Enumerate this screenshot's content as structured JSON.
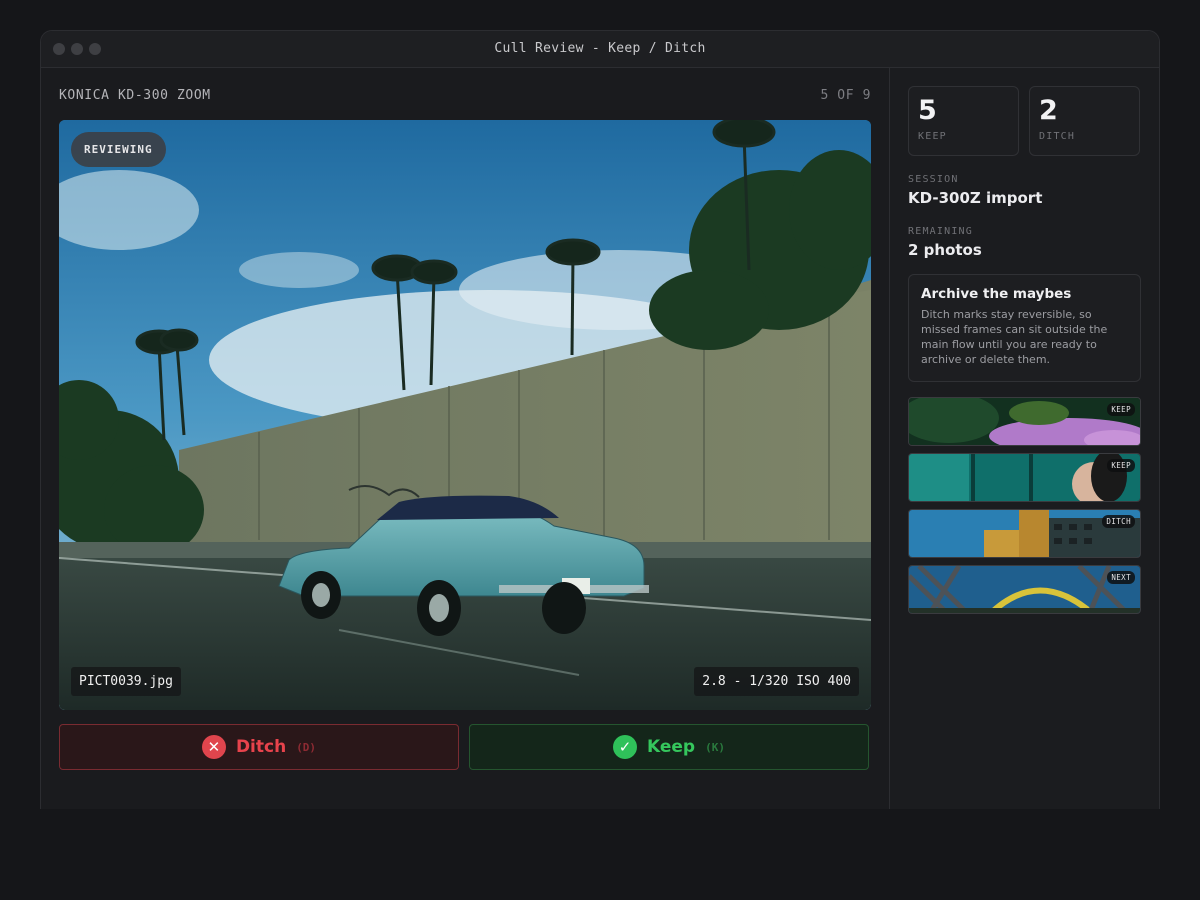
{
  "window": {
    "title": "Cull Review - Keep / Ditch"
  },
  "header": {
    "camera": "KONICA KD-300 ZOOM",
    "counter": "5 OF 9"
  },
  "photo": {
    "status_badge": "REVIEWING",
    "filename": "PICT0039.jpg",
    "exif": "2.8 - 1/320 ISO 400",
    "description_icon": "photo-vintage-car-highway"
  },
  "actions": {
    "ditch": {
      "label": "Ditch",
      "key": "(D)",
      "icon": "x-icon",
      "color": "#e8434c"
    },
    "keep": {
      "label": "Keep",
      "key": "(K)",
      "icon": "check-icon",
      "color": "#35c75d"
    }
  },
  "stats": {
    "keep": {
      "value": "5",
      "label": "KEEP"
    },
    "ditch": {
      "value": "2",
      "label": "DITCH"
    }
  },
  "session": {
    "label": "SESSION",
    "value": "KD-300Z import"
  },
  "remaining": {
    "label": "REMAINING",
    "value": "2 photos"
  },
  "note": {
    "title": "Archive the maybes",
    "body": "Ditch marks stay reversible, so missed frames can sit outside the main flow until you are ready to archive or delete them."
  },
  "thumbnails": [
    {
      "badge": "KEEP",
      "subject": "lavender-flowers"
    },
    {
      "badge": "KEEP",
      "subject": "portrait-teal-window"
    },
    {
      "badge": "DITCH",
      "subject": "apartment-building"
    },
    {
      "badge": "NEXT",
      "subject": "yellow-arch-bridge"
    }
  ]
}
